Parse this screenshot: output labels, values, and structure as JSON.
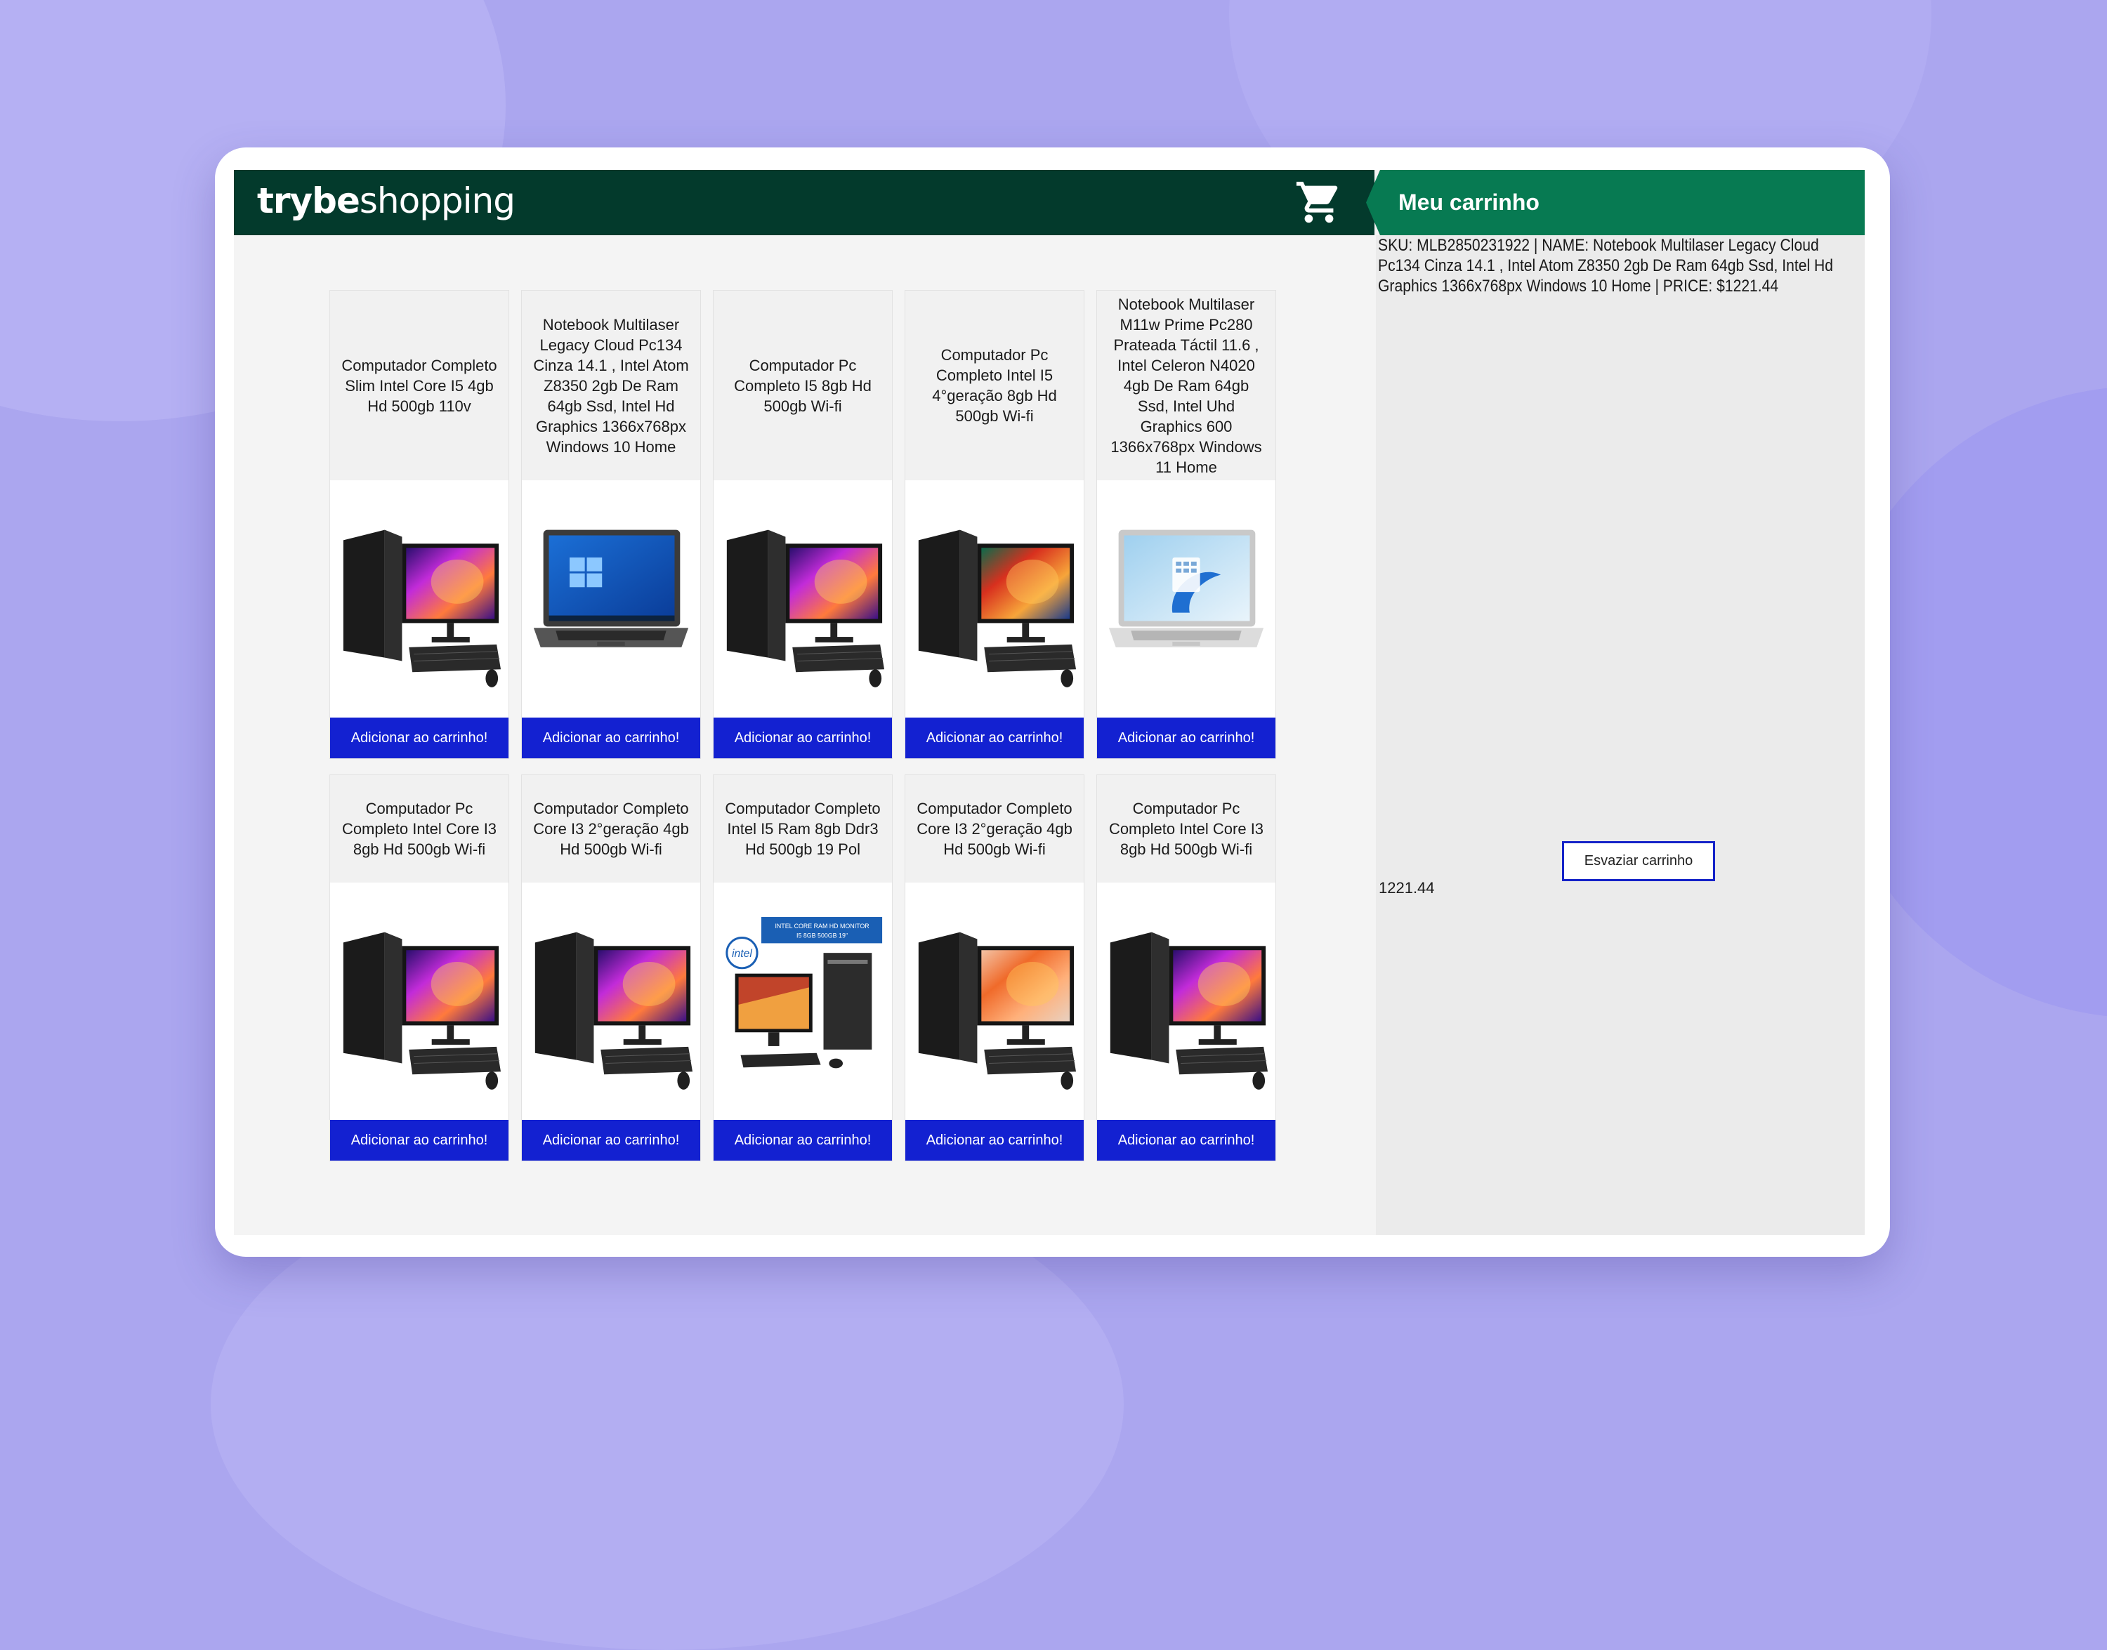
{
  "brand": {
    "name_bold": "trybe",
    "name_light": "shopping"
  },
  "cart": {
    "title": "Meu carrinho",
    "items": [
      "SKU: MLB2850231922 | NAME: Notebook Multilaser Legacy Cloud Pc134 Cinza 14.1 , Intel Atom Z8350 2gb De Ram 64gb Ssd, Intel Hd Graphics 1366x768px Windows 10 Home | PRICE: $1221.44"
    ],
    "empty_label": "Esvaziar carrinho",
    "total": "1221.44"
  },
  "products": [
    {
      "title": "Computador Completo Slim Intel Core I5 4gb Hd 500gb 110v",
      "image": "desktop-pc",
      "button": "Adicionar ao carrinho!"
    },
    {
      "title": "Notebook Multilaser Legacy Cloud Pc134 Cinza 14.1 , Intel Atom Z8350 2gb De Ram 64gb Ssd, Intel Hd Graphics 1366x768px Windows 10 Home",
      "image": "laptop-windows10",
      "button": "Adicionar ao carrinho!"
    },
    {
      "title": "Computador Pc Completo I5 8gb Hd 500gb Wi-fi",
      "image": "desktop-pc",
      "button": "Adicionar ao carrinho!"
    },
    {
      "title": "Computador Pc Completo Intel I5 4°geração 8gb Hd 500gb Wi-fi",
      "image": "desktop-pc-red",
      "button": "Adicionar ao carrinho!"
    },
    {
      "title": "Notebook Multilaser M11w Prime Pc280 Prateada Táctil 11.6 , Intel Celeron N4020 4gb De Ram 64gb Ssd, Intel Uhd Graphics 600 1366x768px Windows 11 Home",
      "image": "laptop-windows11",
      "button": "Adicionar ao carrinho!"
    },
    {
      "title": "Computador Pc Completo Intel Core I3 8gb Hd 500gb Wi-fi",
      "image": "desktop-pc",
      "button": "Adicionar ao carrinho!"
    },
    {
      "title": "Computador Completo Core I3 2°geração 4gb Hd 500gb Wi-fi",
      "image": "desktop-pc",
      "button": "Adicionar ao carrinho!"
    },
    {
      "title": "Computador Completo Intel I5 Ram 8gb Ddr3 Hd 500gb 19 Pol",
      "image": "desktop-pc-intel-banner",
      "button": "Adicionar ao carrinho!"
    },
    {
      "title": "Computador Completo Core I3 2°geração 4gb Hd 500gb Wi-fi",
      "image": "desktop-pc-orange",
      "button": "Adicionar ao carrinho!"
    },
    {
      "title": "Computador Pc Completo Intel Core I3 8gb Hd 500gb Wi-fi",
      "image": "desktop-pc",
      "button": "Adicionar ao carrinho!"
    }
  ],
  "banner_text": {
    "line1": "INTEL CORE   RAM   HD   MONITOR",
    "line2": "I5   8GB   500GB   19\"",
    "intel_logo": "intel"
  }
}
